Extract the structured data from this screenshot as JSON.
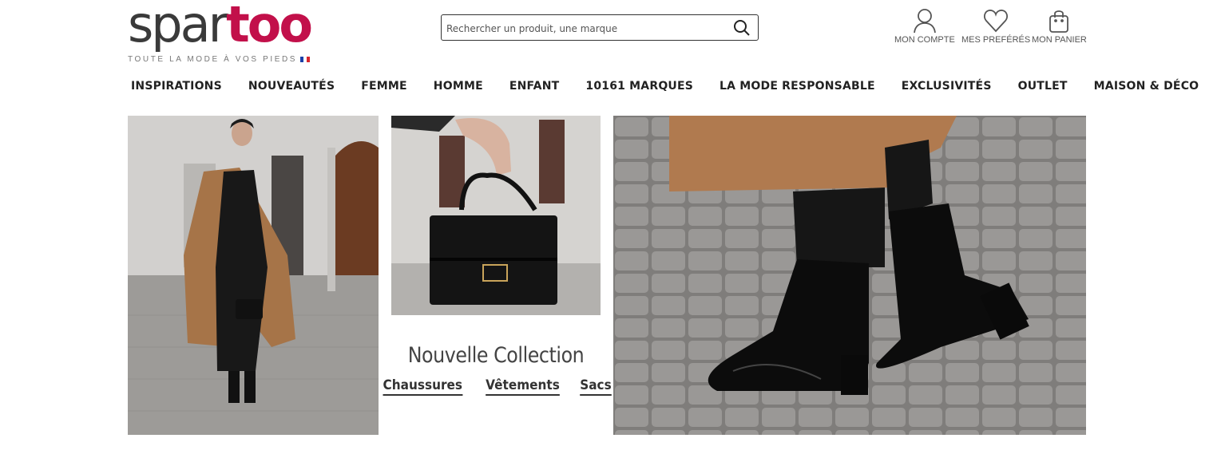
{
  "header": {
    "logo": {
      "part1": "spar",
      "part2": "too",
      "tagline": "TOUTE LA MODE À VOS PIEDS"
    },
    "search": {
      "placeholder": "Rechercher un produit, une marque"
    },
    "account": [
      {
        "label": "MON COMPTE",
        "icon": "user-icon"
      },
      {
        "label": "MES PREFÉRÉS",
        "icon": "heart-icon"
      },
      {
        "label": "MON PANIER",
        "icon": "shopping-bag-icon"
      }
    ]
  },
  "nav": [
    "INSPIRATIONS",
    "NOUVEAUTÉS",
    "FEMME",
    "HOMME",
    "ENFANT",
    "10161 MARQUES",
    "LA MODE RESPONSABLE",
    "EXCLUSIVITÉS",
    "OUTLET",
    "MAISON & DÉCO"
  ],
  "collection": {
    "title": "Nouvelle Collection",
    "links": [
      "Chaussures",
      "Vêtements",
      "Sacs"
    ]
  },
  "colors": {
    "brand_red": "#c2104a",
    "text_dark": "#3a3a3a"
  }
}
